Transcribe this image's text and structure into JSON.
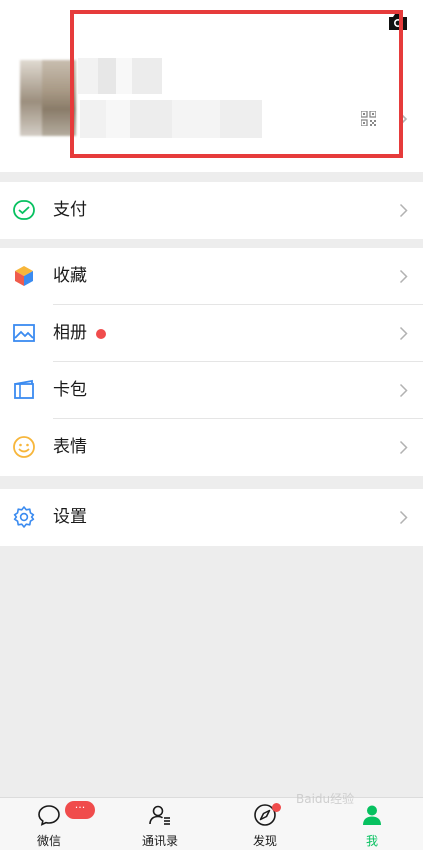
{
  "profile": {
    "qr_icon": "qr-code-icon",
    "camera_icon": "camera-icon",
    "highlight_color": "#e63b3b"
  },
  "menu": {
    "pay": {
      "label": "支付",
      "icon": "pay-icon"
    },
    "favorites": {
      "label": "收藏",
      "icon": "favorites-cube-icon"
    },
    "album": {
      "label": "相册",
      "icon": "album-image-icon",
      "has_dot": true
    },
    "cards": {
      "label": "卡包",
      "icon": "wallet-card-icon"
    },
    "stickers": {
      "label": "表情",
      "icon": "smiley-icon"
    },
    "settings": {
      "label": "设置",
      "icon": "gear-icon"
    }
  },
  "tabbar": {
    "chats": {
      "label": "微信",
      "badge": "···",
      "icon": "chat-bubble-icon"
    },
    "contacts": {
      "label": "通讯录",
      "icon": "contacts-icon"
    },
    "discover": {
      "label": "发现",
      "icon": "compass-icon",
      "has_dot": true
    },
    "me": {
      "label": "我",
      "icon": "person-icon",
      "active": true
    }
  },
  "watermark": "Baidu经验",
  "colors": {
    "accent": "#07c160",
    "badge": "#f04c4c",
    "background": "#ededed"
  }
}
